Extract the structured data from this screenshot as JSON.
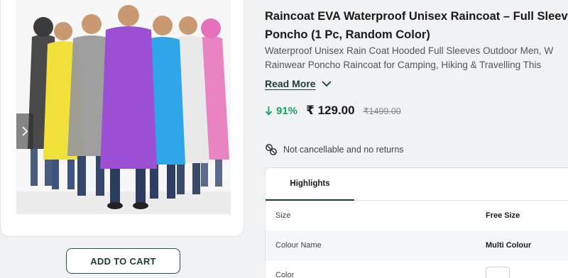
{
  "product": {
    "title_line1": "Raincoat EVA Waterproof Unisex Raincoat – Full Sleeves",
    "title_line2": "Poncho (1 Pc, Random Color)",
    "description_line1": "Waterproof Unisex Rain Coat Hooded Full Sleeves Outdoor Men, W",
    "description_line2": "Rainwear Poncho Raincoat for Camping, Hiking & Travelling This",
    "read_more": "Read More",
    "discount": "91%",
    "price": "₹ 129.00",
    "mrp": "₹1499.00",
    "policy": "Not cancellable and no returns",
    "image_colors": [
      "#3b3b3b",
      "#f2e03a",
      "#9a9a9a",
      "#9b4fd3",
      "#2ea6e8",
      "#e9e9e9",
      "#e86fb9"
    ]
  },
  "actions": {
    "add_to_cart": "ADD TO CART"
  },
  "highlights": {
    "tab_label": "Highlights",
    "rows": [
      {
        "key": "Size",
        "value": "Free Size"
      },
      {
        "key": "Colour Name",
        "value": "Multi Colour"
      },
      {
        "key": "Color",
        "value": ""
      }
    ]
  },
  "colors": {
    "accent": "#1d3b36",
    "discount": "#1aa36b",
    "background": "#f1f2f4"
  },
  "icons": {
    "carousel": "chevron-right-icon",
    "read_more": "chevron-down-icon",
    "discount": "arrow-down-icon",
    "policy": "no-return-icon"
  }
}
